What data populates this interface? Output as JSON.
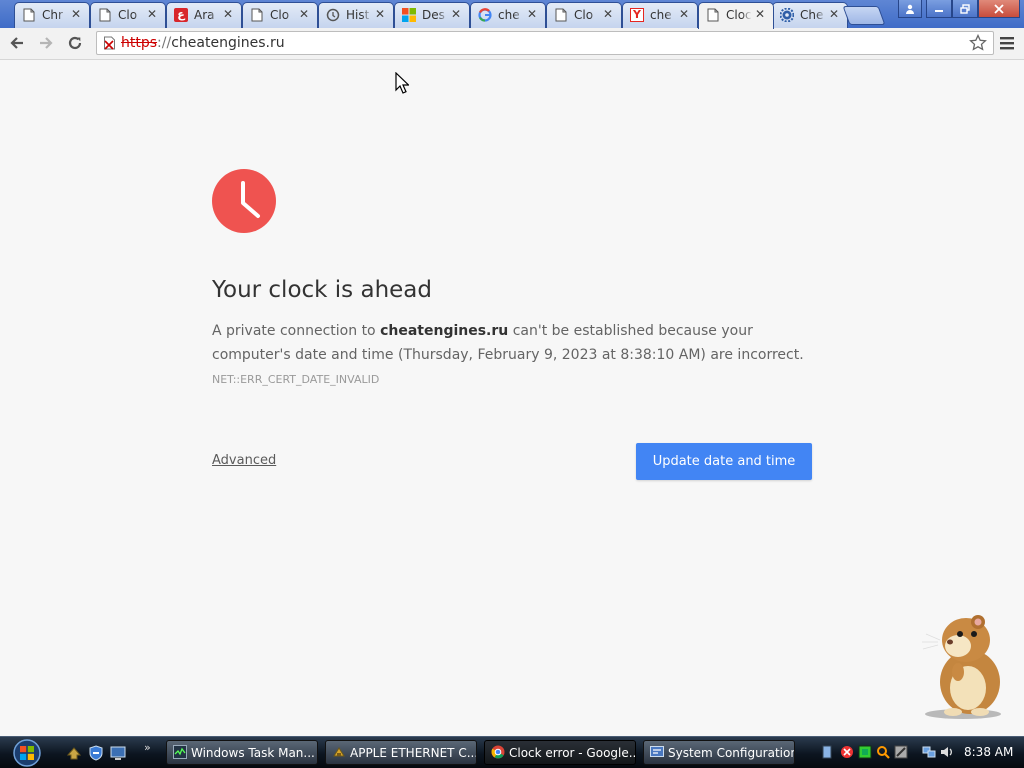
{
  "tabs": [
    {
      "label": "Chr",
      "icon": "page-icon"
    },
    {
      "label": "Clo",
      "icon": "page-icon"
    },
    {
      "label": "Ara",
      "icon": "arabic-site-icon"
    },
    {
      "label": "Clo",
      "icon": "page-icon"
    },
    {
      "label": "Hist",
      "icon": "history-icon"
    },
    {
      "label": "Des",
      "icon": "windows-logo-icon"
    },
    {
      "label": "che",
      "icon": "google-icon"
    },
    {
      "label": "Clo",
      "icon": "page-icon"
    },
    {
      "label": "che",
      "icon": "yandex-icon"
    },
    {
      "label": "Cloc",
      "icon": "page-icon",
      "active": true
    },
    {
      "label": "Che",
      "icon": "gear-icon"
    }
  ],
  "omnibox": {
    "scheme": "https",
    "separator": "://",
    "host": "cheatengines.ru"
  },
  "error_page": {
    "title": "Your clock is ahead",
    "message_prefix": "A private connection to ",
    "message_host": "cheatengines.ru",
    "message_suffix": " can't be established because your computer's date and time (Thursday, February 9, 2023 at 8:38:10 AM) are incorrect.",
    "error_code": "NET::ERR_CERT_DATE_INVALID",
    "advanced_label": "Advanced",
    "update_button_label": "Update date and time"
  },
  "taskbar": {
    "quick_launch_more": "»",
    "buttons": [
      {
        "label": "Windows Task Man...",
        "icon": "task-manager-icon"
      },
      {
        "label": "APPLE ETHERNET C...",
        "icon": "network-adapter-icon"
      },
      {
        "label": "Clock error - Google...",
        "icon": "chrome-icon",
        "active": true
      },
      {
        "label": "System Configuration",
        "icon": "system-config-icon"
      }
    ],
    "clock": "8:38 AM"
  },
  "colors": {
    "accent_blue": "#4285f4",
    "clock_red": "#ef5350",
    "titlebar_blue": "#4a74c9"
  }
}
